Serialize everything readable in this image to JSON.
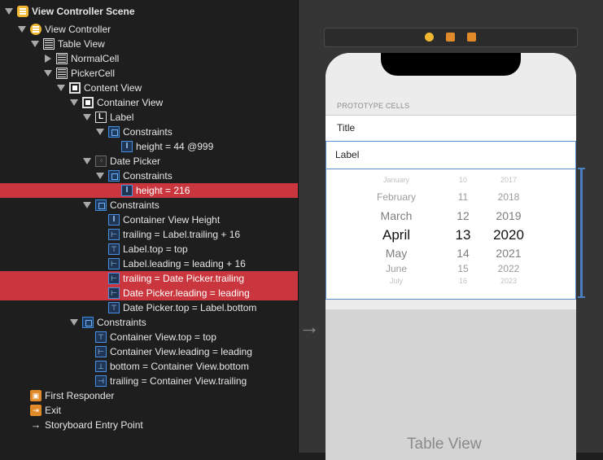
{
  "outline": {
    "scene": "View Controller Scene",
    "view_controller": "View Controller",
    "table_view": "Table View",
    "normal_cell": "NormalCell",
    "picker_cell": "PickerCell",
    "content_view": "Content View",
    "container_view": "Container View",
    "label": "Label",
    "label_constraints": "Constraints",
    "label_height": "height = 44 @999",
    "date_picker": "Date Picker",
    "date_picker_constraints": "Constraints",
    "date_picker_height": "height = 216",
    "container_constraints": "Constraints",
    "c_container_height": "Container View Height",
    "c_trailing_label": "trailing = Label.trailing + 16",
    "c_label_top": "Label.top = top",
    "c_label_leading": "Label.leading = leading + 16",
    "c_trailing_dp": "trailing = Date Picker.trailing",
    "c_dp_leading": "Date Picker.leading = leading",
    "c_dp_top": "Date Picker.top = Label.bottom",
    "content_constraints": "Constraints",
    "c_cv_top": "Container View.top = top",
    "c_cv_leading": "Container View.leading = leading",
    "c_bottom_cv": "bottom = Container View.bottom",
    "c_trailing_cv": "trailing = Container View.trailing",
    "first_responder": "First Responder",
    "exit": "Exit",
    "entry_point": "Storyboard Entry Point"
  },
  "canvas": {
    "prototype_header": "PROTOTYPE CELLS",
    "title_cell": "Title",
    "label_cell": "Label",
    "picker": {
      "months": [
        "January",
        "February",
        "March",
        "April",
        "May",
        "June",
        "July"
      ],
      "days": [
        "10",
        "11",
        "12",
        "13",
        "14",
        "15",
        "16"
      ],
      "years": [
        "2017",
        "2018",
        "2019",
        "2020",
        "2021",
        "2022",
        "2023"
      ]
    },
    "table_view_placeholder": "Table View",
    "icons": [
      "view-controller-icon",
      "first-responder-icon",
      "exit-icon"
    ]
  },
  "colors": {
    "selection": "#c9363d",
    "accent": "#4a7fc4",
    "scene_icon": "#f0b731"
  }
}
